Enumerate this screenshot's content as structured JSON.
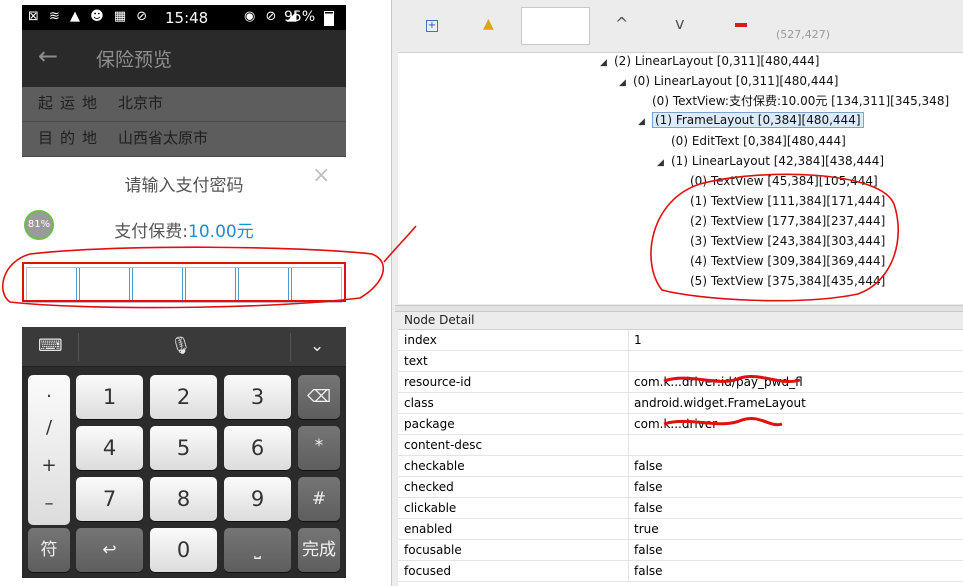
{
  "phone": {
    "status": {
      "left_icons": "⊠ ≋ ▲ ☻ ▦ ⊘",
      "time": "15:48",
      "right_icons": "◉ ⊘ ◢",
      "battery": "95%"
    },
    "app_bar": {
      "back_glyph": "←",
      "title": "保险预览"
    },
    "rows": [
      {
        "label": "起运地",
        "value": "北京市"
      },
      {
        "label": "目的地",
        "value": "山西省太原市"
      }
    ],
    "dialog": {
      "title": "请输入支付密码",
      "close_glyph": "×",
      "fee_label": "支付保费:",
      "fee_amount": "10.00元"
    },
    "progress_badge": "81%",
    "password_cells": 6,
    "keyboard": {
      "toolbar": {
        "keyboard_glyph": "⌨",
        "mic_glyph": "🎙",
        "collapse_glyph": "⌄"
      },
      "symbols": [
        ".",
        "/",
        "+",
        "–"
      ],
      "digits": [
        "1",
        "2",
        "3",
        "4",
        "5",
        "6",
        "7",
        "8",
        "9",
        "0"
      ],
      "backspace_glyph": "⌫",
      "star": "*",
      "hash": "#",
      "symbol_key": "符",
      "back_key_glyph": "↩",
      "space_glyph": "⎵",
      "done_key": "完成"
    }
  },
  "inspector": {
    "toolbar": {
      "expand_glyph": "+",
      "warn_glyph": "▲",
      "up_glyph": "^",
      "down_glyph": "v",
      "coords": "(527,427)"
    },
    "tree": [
      {
        "arrow": "◢",
        "text": "(2) LinearLayout [0,311][480,444]"
      },
      {
        "arrow": "◢",
        "text": "(0) LinearLayout [0,311][480,444]"
      },
      {
        "arrow": "",
        "text": "(0) TextView:支付保费:10.00元 [134,311][345,348]"
      },
      {
        "arrow": "◢",
        "text": "(1) FrameLayout [0,384][480,444]"
      },
      {
        "arrow": "",
        "text": "(0) EditText [0,384][480,444]"
      },
      {
        "arrow": "◢",
        "text": "(1) LinearLayout [42,384][438,444]"
      },
      {
        "arrow": "",
        "text": "(0) TextView [45,384][105,444]"
      },
      {
        "arrow": "",
        "text": "(1) TextView [111,384][171,444]"
      },
      {
        "arrow": "",
        "text": "(2) TextView [177,384][237,444]"
      },
      {
        "arrow": "",
        "text": "(3) TextView [243,384][303,444]"
      },
      {
        "arrow": "",
        "text": "(4) TextView [309,384][369,444]"
      },
      {
        "arrow": "",
        "text": "(5) TextView [375,384][435,444]"
      }
    ],
    "detail": {
      "header": "Node Detail",
      "rows": [
        {
          "key": "index",
          "value": "1"
        },
        {
          "key": "text",
          "value": ""
        },
        {
          "key": "resource-id",
          "value": "com.k...driver:id/pay_pwd_fl"
        },
        {
          "key": "class",
          "value": "android.widget.FrameLayout"
        },
        {
          "key": "package",
          "value": "com.k...driver"
        },
        {
          "key": "content-desc",
          "value": ""
        },
        {
          "key": "checkable",
          "value": "false"
        },
        {
          "key": "checked",
          "value": "false"
        },
        {
          "key": "clickable",
          "value": "false"
        },
        {
          "key": "enabled",
          "value": "true"
        },
        {
          "key": "focusable",
          "value": "false"
        },
        {
          "key": "focused",
          "value": "false"
        }
      ]
    }
  },
  "colors": {
    "accent_blue": "#1a8fd6",
    "annotation_red": "#e01010",
    "selection_bg": "#dcebfb"
  }
}
